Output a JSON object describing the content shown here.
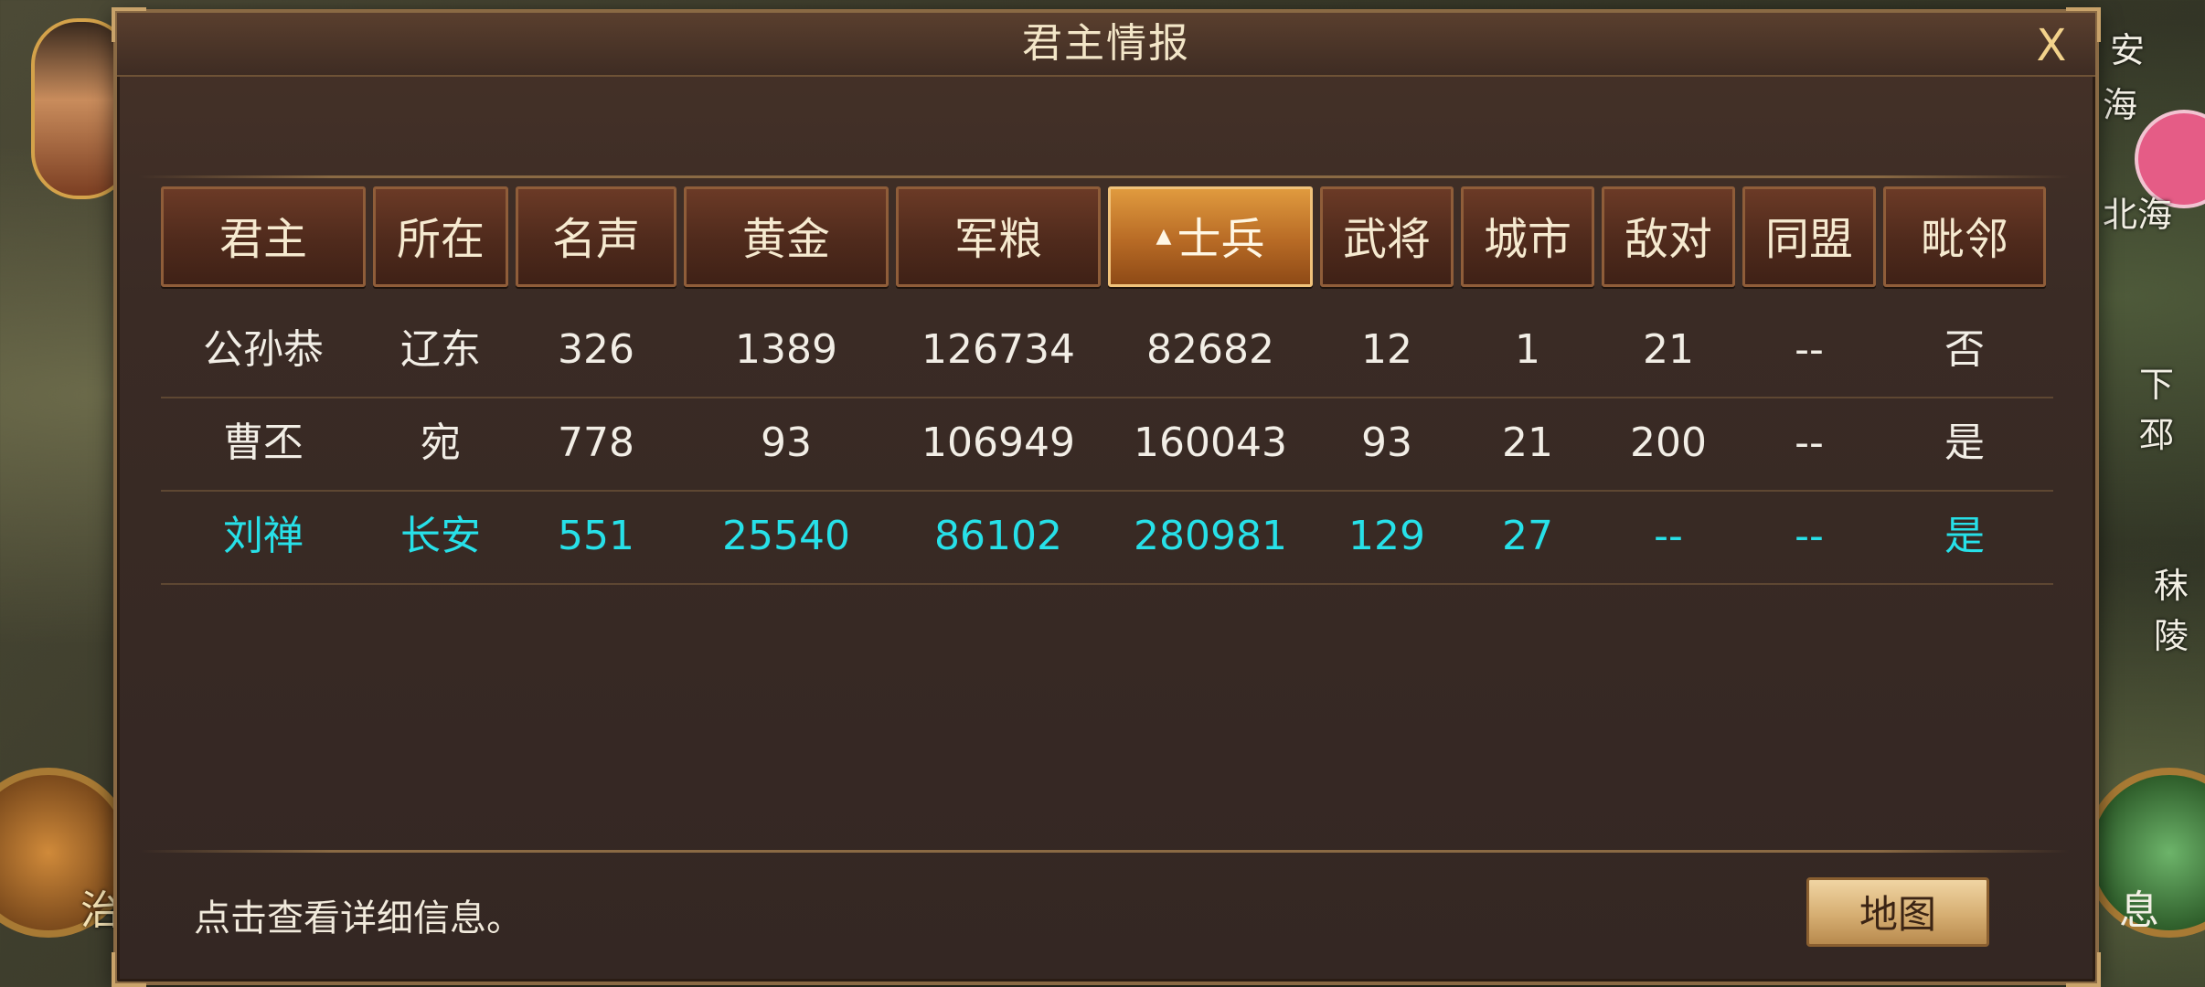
{
  "dialog": {
    "title": "君主情报",
    "close_label": "X",
    "hint": "点击查看详细信息。",
    "map_button": "地图"
  },
  "table": {
    "columns": [
      "君主",
      "所在",
      "名声",
      "黄金",
      "军粮",
      "士兵",
      "武将",
      "城市",
      "敌对",
      "同盟",
      "毗邻"
    ],
    "sorted_column": "士兵",
    "sort_indicator": "▲",
    "rows": [
      [
        "公孙恭",
        "辽东",
        "326",
        "1389",
        "126734",
        "82682",
        "12",
        "1",
        "21",
        "--",
        "否"
      ],
      [
        "曹丕",
        "宛",
        "778",
        "93",
        "106949",
        "160043",
        "93",
        "21",
        "200",
        "--",
        "是"
      ],
      [
        "刘禅",
        "长安",
        "551",
        "25540",
        "86102",
        "280981",
        "129",
        "27",
        "--",
        "--",
        "是"
      ]
    ],
    "player_row_index": 2,
    "player_color": "#27e0e8"
  },
  "background": {
    "right_labels": [
      "安",
      "海",
      "北海",
      "下邳",
      "秣陵"
    ],
    "left_label": "治",
    "right_bottom_label": "息"
  }
}
